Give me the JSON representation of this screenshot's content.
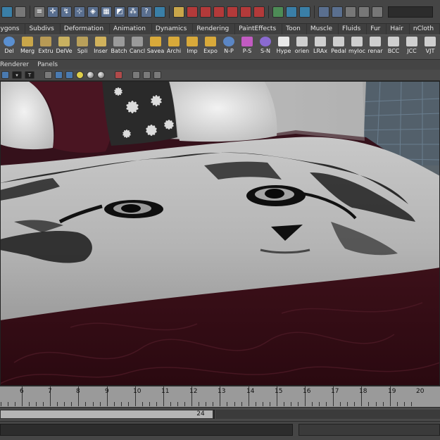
{
  "shelf_tabs": [
    "lygons",
    "Subdivs",
    "Deformation",
    "Animation",
    "Dynamics",
    "Rendering",
    "PaintEffects",
    "Toon",
    "Muscle",
    "Fluids",
    "Fur",
    "Hair",
    "nCloth"
  ],
  "shelf_buttons": [
    {
      "label": "Del",
      "icon": "sphere-icon",
      "color": "#5a8fd0"
    },
    {
      "label": "Merg",
      "icon": "merge-icon",
      "color": "#c9a64a"
    },
    {
      "label": "Extru",
      "icon": "extrude-icon",
      "color": "#b89a55"
    },
    {
      "label": "DelVe",
      "icon": "delete-vertex-icon",
      "color": "#c8b060"
    },
    {
      "label": "Spli",
      "icon": "split-icon",
      "color": "#b9a05a"
    },
    {
      "label": "Inser",
      "icon": "insert-loop-icon",
      "color": "#d1b25c"
    },
    {
      "label": "Batch",
      "icon": "batch-icon",
      "color": "#9a9a9a"
    },
    {
      "label": "Cancl",
      "icon": "cancel-icon",
      "color": "#9a9a9a"
    },
    {
      "label": "Savea",
      "icon": "folder-icon",
      "color": "#d8a93a"
    },
    {
      "label": "Archi",
      "icon": "folder-icon",
      "color": "#d8a93a"
    },
    {
      "label": "Imp",
      "icon": "folder-icon",
      "color": "#d8a93a"
    },
    {
      "label": "Expo",
      "icon": "folder-icon",
      "color": "#d8a93a"
    },
    {
      "label": "N-P",
      "icon": "sphere-icon",
      "color": "#5b86c4"
    },
    {
      "label": "P-S",
      "icon": "paint-icon",
      "color": "#c25bc2"
    },
    {
      "label": "S-N",
      "icon": "sphere-icon",
      "color": "#8a6ad0"
    },
    {
      "label": "Hype",
      "icon": "hypershade-icon",
      "color": "#e8e8e8"
    },
    {
      "label": "orien",
      "icon": "script-icon",
      "color": "#cfcfcf"
    },
    {
      "label": "LRAx",
      "icon": "axis-icon",
      "color": "#cfcfcf"
    },
    {
      "label": "Pedal",
      "icon": "script-icon",
      "color": "#cfcfcf"
    },
    {
      "label": "myloc",
      "icon": "script-icon",
      "color": "#cfcfcf"
    },
    {
      "label": "renar",
      "icon": "script-icon",
      "color": "#cfcfcf"
    },
    {
      "label": "BCC",
      "icon": "script-icon",
      "color": "#cfcfcf"
    },
    {
      "label": "JCC",
      "icon": "script-icon",
      "color": "#cfcfcf"
    },
    {
      "label": "VJT",
      "icon": "script-icon",
      "color": "#cfcfcf"
    }
  ],
  "panel_menu": [
    "Renderer",
    "Panels"
  ],
  "timeline": {
    "ticks": [
      "6",
      "7",
      "8",
      "9",
      "10",
      "11",
      "12",
      "13",
      "14",
      "15",
      "16",
      "17",
      "18",
      "19",
      "20"
    ]
  },
  "range": {
    "end_value": "24"
  },
  "colors": {
    "ui_bg": "#444444",
    "timeline_bg": "#9a9a9a",
    "bedding_maroon": "#3a0f1a",
    "blanket_grey": "#bdbdbd"
  }
}
